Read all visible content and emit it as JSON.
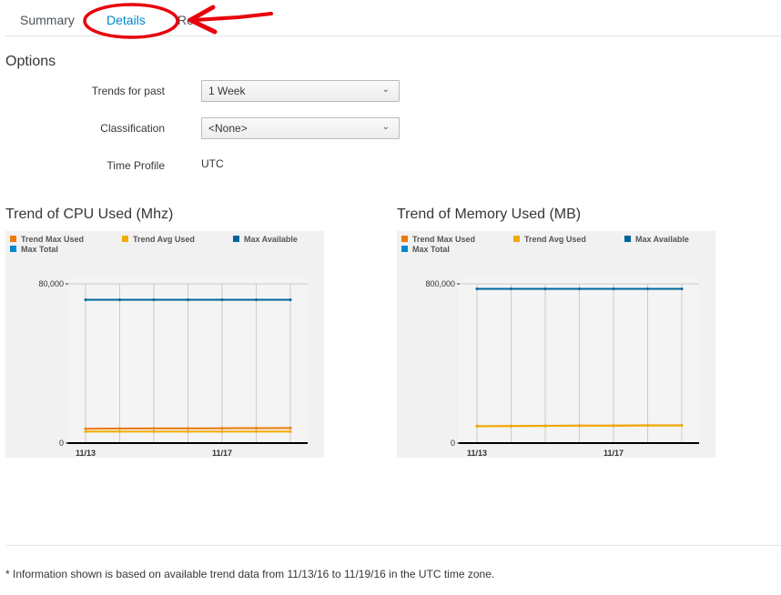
{
  "tabs": [
    {
      "label": "Summary",
      "active": false
    },
    {
      "label": "Details",
      "active": true
    },
    {
      "label": "Reports",
      "active": false
    }
  ],
  "options": {
    "title": "Options",
    "trends_for_past": {
      "label": "Trends for past",
      "value": "1 Week"
    },
    "classification": {
      "label": "Classification",
      "value": "<None>"
    },
    "time_profile": {
      "label": "Time Profile",
      "value": "UTC"
    }
  },
  "colors": {
    "trend_max_used": "#ec7a08",
    "trend_avg_used": "#f0ab00",
    "max_available": "#00659c",
    "max_total": "#0088ce",
    "active_tab": "#0088ce",
    "annotation": "#e8000b"
  },
  "chart_data": [
    {
      "type": "line",
      "title": "Trend of CPU Used (Mhz)",
      "legend": [
        "Trend Max Used",
        "Trend Avg Used",
        "Max Available",
        "Max Total"
      ],
      "legend_position": "top",
      "x_tick_labels": [
        "11/13",
        "11/17"
      ],
      "y_tick_labels": [
        "0",
        "80,000"
      ],
      "ylim": [
        0,
        80000
      ],
      "x": [
        "11/13",
        "11/14",
        "11/15",
        "11/16",
        "11/17",
        "11/18",
        "11/19"
      ],
      "series": [
        {
          "name": "Trend Max Used",
          "values": [
            7200,
            7300,
            7350,
            7400,
            7450,
            7500,
            7550
          ]
        },
        {
          "name": "Trend Avg Used",
          "values": [
            5800,
            5800,
            5800,
            5800,
            5800,
            5800,
            5800
          ]
        },
        {
          "name": "Max Available",
          "values": [
            72000,
            72000,
            72000,
            72000,
            72000,
            72000,
            72000
          ]
        }
      ]
    },
    {
      "type": "line",
      "title": "Trend of Memory Used (MB)",
      "legend": [
        "Trend Max Used",
        "Trend Avg Used",
        "Max Available",
        "Max Total"
      ],
      "legend_position": "top",
      "x_tick_labels": [
        "11/13",
        "11/17"
      ],
      "y_tick_labels": [
        "0",
        "800,000"
      ],
      "ylim": [
        0,
        800000
      ],
      "x": [
        "11/13",
        "11/14",
        "11/15",
        "11/16",
        "11/17",
        "11/18",
        "11/19"
      ],
      "series": [
        {
          "name": "Trend Max Used",
          "values": [
            85000,
            86000,
            87000,
            88000,
            88000,
            89000,
            89000
          ]
        },
        {
          "name": "Trend Avg Used",
          "values": [
            84000,
            85000,
            86000,
            87000,
            87000,
            88000,
            88000
          ]
        },
        {
          "name": "Max Available",
          "values": [
            775000,
            775000,
            775000,
            775000,
            775000,
            775000,
            775000
          ]
        }
      ]
    }
  ],
  "footnote": "* Information shown is based on available trend data from 11/13/16 to 11/19/16 in the UTC time zone."
}
